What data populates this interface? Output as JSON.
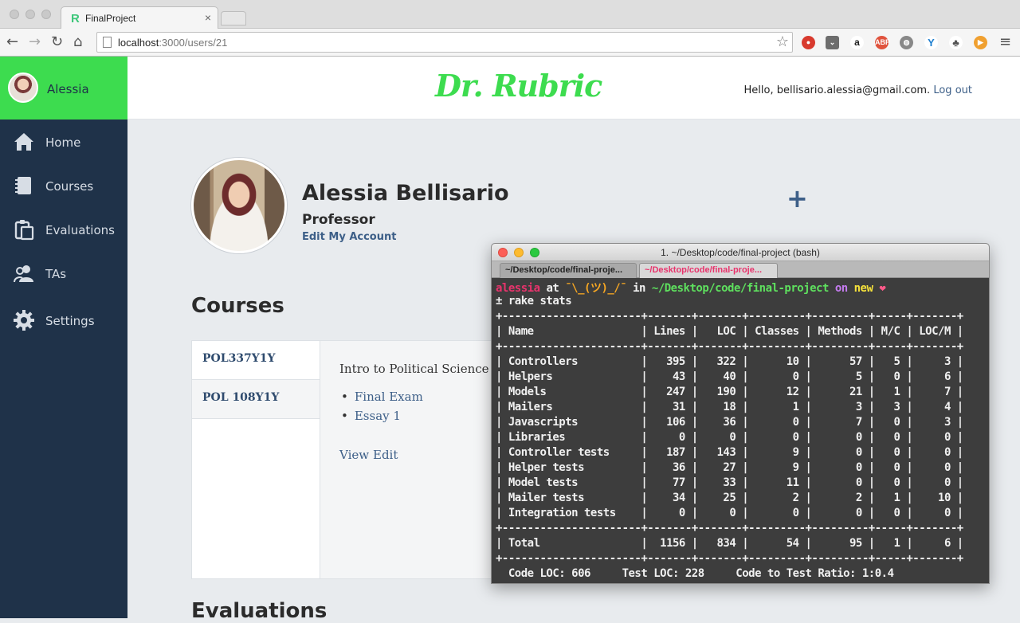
{
  "browser": {
    "tab_title": "FinalProject",
    "tab_favicon": "R",
    "tab_close": "×",
    "url_host": "localhost",
    "url_rest": ":3000/users/21",
    "icons": [
      "back-icon",
      "forward-icon",
      "reload-icon",
      "home-icon",
      "bookmark-star-icon",
      "menu-icon"
    ]
  },
  "sidebar": {
    "user_name": "Alessia",
    "items": [
      {
        "label": "Home",
        "icon": "home-icon"
      },
      {
        "label": "Courses",
        "icon": "book-icon"
      },
      {
        "label": "Evaluations",
        "icon": "clipboard-icon"
      },
      {
        "label": "TAs",
        "icon": "people-icon"
      },
      {
        "label": "Settings",
        "icon": "gear-icon"
      }
    ]
  },
  "header": {
    "brand": "Dr. Rubric",
    "greeting": "Hello, bellisario.alessia@gmail.com.",
    "logout": "Log out",
    "brand_color": "#3ddc4f"
  },
  "profile": {
    "name": "Alessia Bellisario",
    "role": "Professor",
    "edit_link": "Edit My Account",
    "add_button": "+"
  },
  "courses": {
    "title": "Courses",
    "tabs": [
      "POL337Y1Y",
      "POL 108Y1Y"
    ],
    "selected_title": "Intro to Political Science",
    "evaluations": [
      "Final Exam",
      "Essay 1"
    ],
    "view_link": "View",
    "edit_link": "Edit"
  },
  "evaluations_section": {
    "title": "Evaluations"
  },
  "terminal": {
    "window_title": "1. ~/Desktop/code/final-project (bash)",
    "tabs": [
      "~/Desktop/code/final-proje...",
      "~/Desktop/code/final-proje..."
    ],
    "prompt": {
      "user": "alessia",
      "at": " at ",
      "host": "¯\\_(ツ)_/¯",
      "in": " in ",
      "path": "~/Desktop/code/final-project",
      "on": " on ",
      "branch": "new",
      "heart": " ❤"
    },
    "command": "± rake stats",
    "lines": [
      "+----------------------+-------+-------+---------+---------+-----+-------+",
      "| Name                 | Lines |   LOC | Classes | Methods | M/C | LOC/M |",
      "+----------------------+-------+-------+---------+---------+-----+-------+",
      "| Controllers          |   395 |   322 |      10 |      57 |   5 |     3 |",
      "| Helpers              |    43 |    40 |       0 |       5 |   0 |     6 |",
      "| Models               |   247 |   190 |      12 |      21 |   1 |     7 |",
      "| Mailers              |    31 |    18 |       1 |       3 |   3 |     4 |",
      "| Javascripts          |   106 |    36 |       0 |       7 |   0 |     3 |",
      "| Libraries            |     0 |     0 |       0 |       0 |   0 |     0 |",
      "| Controller tests     |   187 |   143 |       9 |       0 |   0 |     0 |",
      "| Helper tests         |    36 |    27 |       9 |       0 |   0 |     0 |",
      "| Model tests          |    77 |    33 |      11 |       0 |   0 |     0 |",
      "| Mailer tests         |    34 |    25 |       2 |       2 |   1 |    10 |",
      "| Integration tests    |     0 |     0 |       0 |       0 |   0 |     0 |",
      "+----------------------+-------+-------+---------+---------+-----+-------+",
      "| Total                |  1156 |   834 |      54 |      95 |   1 |     6 |",
      "+----------------------+-------+-------+---------+---------+-----+-------+",
      "  Code LOC: 606     Test LOC: 228     Code to Test Ratio: 1:0.4"
    ]
  }
}
